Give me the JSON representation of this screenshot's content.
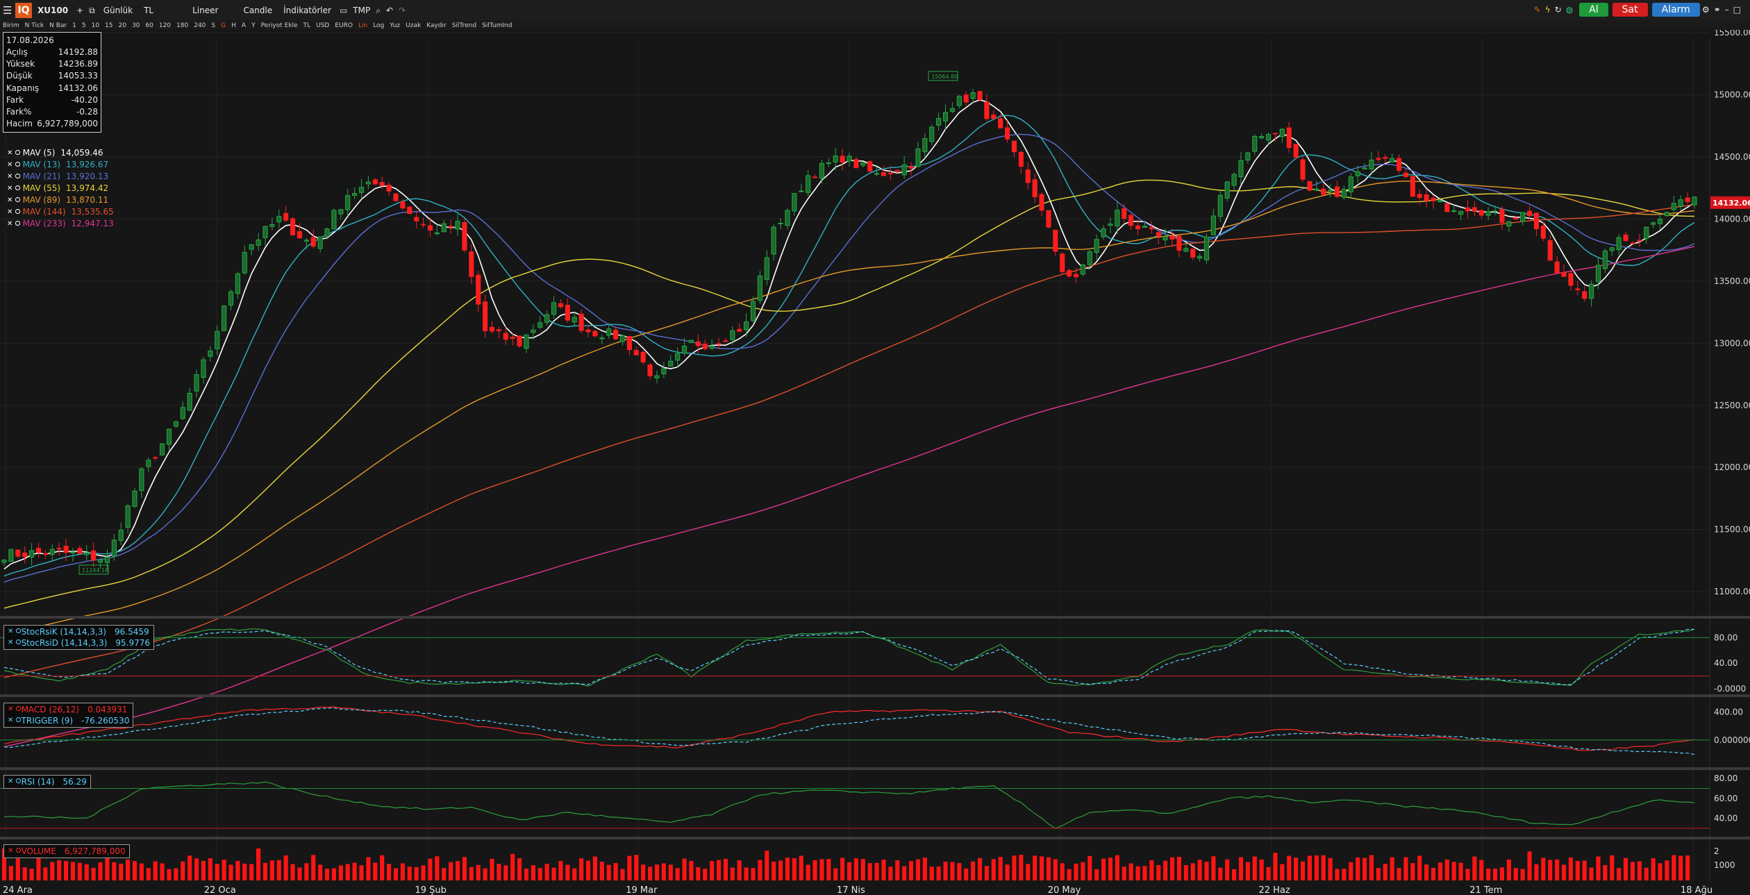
{
  "toolbar": {
    "logo": "IQ",
    "symbol": "XU100",
    "plus": "+",
    "period": "Günlük",
    "currency": "TL",
    "scale": "Lineer",
    "chart_type": "Candle",
    "indicators": "İndikatörler",
    "tmp": "TMP",
    "buy": "Al",
    "sell": "Sat",
    "alarm": "Alarm"
  },
  "subbar": [
    "Birim",
    "N Tick",
    "N Bar",
    "1",
    "5",
    "10",
    "15",
    "20",
    "30",
    "60",
    "120",
    "180",
    "240",
    "S",
    "G",
    "H",
    "A",
    "Y",
    "Periyot Ekle",
    "TL",
    "USD",
    "EURO",
    "Lin",
    "Log",
    "Yuz",
    "Uzak",
    "Kaydır",
    "SilTrend",
    "SilTumInd"
  ],
  "info": {
    "date": "17.08.2026",
    "rows": [
      {
        "label": "Açılış",
        "value": "14192.88"
      },
      {
        "label": "Yüksek",
        "value": "14236.89"
      },
      {
        "label": "Düşük",
        "value": "14053.33"
      },
      {
        "label": "Kapanış",
        "value": "14132.06"
      },
      {
        "label": "Fark",
        "value": "-40.20"
      },
      {
        "label": "Fark%",
        "value": "-0.28"
      },
      {
        "label": "Hacim",
        "value": "6,927,789,000"
      }
    ]
  },
  "mav_legend": [
    {
      "name": "MAV (5)",
      "value": "14,059.46",
      "color": "#ffffff"
    },
    {
      "name": "MAV (13)",
      "value": "13,926.67",
      "color": "#2fb3c7"
    },
    {
      "name": "MAV (21)",
      "value": "13,920.13",
      "color": "#5c6fd6"
    },
    {
      "name": "MAV (55)",
      "value": "13,974.42",
      "color": "#e8d83a"
    },
    {
      "name": "MAV (89)",
      "value": "13,870.11",
      "color": "#e69a2a"
    },
    {
      "name": "MAV (144)",
      "value": "13,535.65",
      "color": "#e0502a"
    },
    {
      "name": "MAV (233)",
      "value": "12,947.13",
      "color": "#e23590"
    }
  ],
  "stoch_legend": [
    {
      "name": "StocRsiK (14,14,3,3)",
      "value": "96.5459"
    },
    {
      "name": "StocRsiD (14,14,3,3)",
      "value": "95.9776"
    }
  ],
  "macd_legend": [
    {
      "name": "MACD (26,12)",
      "value": "0.043931"
    },
    {
      "name": "TRIGGER (9)",
      "value": "-76.260530"
    }
  ],
  "rsi_legend": [
    {
      "name": "RSI (14)",
      "value": "56.29"
    }
  ],
  "volume_legend": [
    {
      "name": "VOLUME",
      "value": "6,927,789,000"
    }
  ],
  "chart_data": {
    "type": "candlestick",
    "symbol": "XU100",
    "ylim": [
      10900,
      15450
    ],
    "y_ticks": [
      "15500.00",
      "15000.00",
      "14500.00",
      "14000.00",
      "13500.00",
      "13000.00",
      "12500.00",
      "12000.00",
      "11500.00",
      "11000.00"
    ],
    "x_ticks": [
      "24 Ara",
      "22 Oca",
      "19 Şub",
      "19 Mar",
      "17 Nis",
      "20 May",
      "22 Haz",
      "21 Tem",
      "18 Ağu"
    ],
    "last_price_label": "14132.06",
    "high_marker": "15064.80",
    "low_marker": "11244.16",
    "close_anchors": [
      [
        0,
        11300
      ],
      [
        8,
        11320
      ],
      [
        15,
        11260
      ],
      [
        20,
        11950
      ],
      [
        25,
        12350
      ],
      [
        30,
        12950
      ],
      [
        35,
        13750
      ],
      [
        40,
        14000
      ],
      [
        45,
        13780
      ],
      [
        50,
        14200
      ],
      [
        55,
        14300
      ],
      [
        58,
        14100
      ],
      [
        62,
        13900
      ],
      [
        66,
        13950
      ],
      [
        70,
        13100
      ],
      [
        75,
        13000
      ],
      [
        80,
        13300
      ],
      [
        85,
        13100
      ],
      [
        90,
        13050
      ],
      [
        95,
        12700
      ],
      [
        100,
        13000
      ],
      [
        103,
        13000
      ],
      [
        108,
        13150
      ],
      [
        112,
        13900
      ],
      [
        117,
        14350
      ],
      [
        122,
        14500
      ],
      [
        127,
        14350
      ],
      [
        132,
        14450
      ],
      [
        137,
        14900
      ],
      [
        141,
        15000
      ],
      [
        145,
        14700
      ],
      [
        150,
        14200
      ],
      [
        154,
        13600
      ],
      [
        156,
        13500
      ],
      [
        158,
        13750
      ],
      [
        162,
        14050
      ],
      [
        166,
        13900
      ],
      [
        170,
        13800
      ],
      [
        174,
        13700
      ],
      [
        178,
        14300
      ],
      [
        182,
        14650
      ],
      [
        186,
        14700
      ],
      [
        190,
        14250
      ],
      [
        194,
        14200
      ],
      [
        198,
        14450
      ],
      [
        202,
        14450
      ],
      [
        206,
        14150
      ],
      [
        210,
        14100
      ],
      [
        214,
        14100
      ],
      [
        218,
        14000
      ],
      [
        222,
        14050
      ],
      [
        226,
        13550
      ],
      [
        230,
        13400
      ],
      [
        234,
        13800
      ],
      [
        238,
        13850
      ],
      [
        240,
        14000
      ],
      [
        244,
        14150
      ],
      [
        246,
        14132
      ]
    ],
    "stoch_k": [
      [
        0,
        28
      ],
      [
        8,
        12
      ],
      [
        15,
        30
      ],
      [
        22,
        78
      ],
      [
        30,
        92
      ],
      [
        38,
        93
      ],
      [
        43,
        75
      ],
      [
        47,
        60
      ],
      [
        52,
        25
      ],
      [
        58,
        10
      ],
      [
        65,
        8
      ],
      [
        75,
        12
      ],
      [
        85,
        5
      ],
      [
        95,
        55
      ],
      [
        100,
        20
      ],
      [
        108,
        75
      ],
      [
        115,
        85
      ],
      [
        125,
        90
      ],
      [
        132,
        58
      ],
      [
        138,
        30
      ],
      [
        145,
        70
      ],
      [
        148,
        40
      ],
      [
        152,
        10
      ],
      [
        158,
        5
      ],
      [
        165,
        20
      ],
      [
        170,
        50
      ],
      [
        178,
        70
      ],
      [
        182,
        92
      ],
      [
        187,
        90
      ],
      [
        195,
        30
      ],
      [
        205,
        20
      ],
      [
        213,
        15
      ],
      [
        222,
        10
      ],
      [
        228,
        5
      ],
      [
        231,
        40
      ],
      [
        238,
        85
      ],
      [
        246,
        92
      ]
    ],
    "stoch_d": [
      [
        0,
        32
      ],
      [
        8,
        18
      ],
      [
        15,
        25
      ],
      [
        22,
        68
      ],
      [
        30,
        88
      ],
      [
        38,
        90
      ],
      [
        43,
        80
      ],
      [
        47,
        65
      ],
      [
        52,
        32
      ],
      [
        58,
        14
      ],
      [
        65,
        10
      ],
      [
        75,
        10
      ],
      [
        85,
        8
      ],
      [
        95,
        48
      ],
      [
        100,
        28
      ],
      [
        108,
        68
      ],
      [
        115,
        82
      ],
      [
        125,
        88
      ],
      [
        132,
        64
      ],
      [
        138,
        36
      ],
      [
        145,
        62
      ],
      [
        148,
        46
      ],
      [
        152,
        16
      ],
      [
        158,
        6
      ],
      [
        165,
        15
      ],
      [
        170,
        42
      ],
      [
        178,
        64
      ],
      [
        182,
        88
      ],
      [
        187,
        92
      ],
      [
        195,
        40
      ],
      [
        205,
        22
      ],
      [
        213,
        18
      ],
      [
        222,
        12
      ],
      [
        228,
        6
      ],
      [
        231,
        28
      ],
      [
        238,
        78
      ],
      [
        246,
        94
      ]
    ],
    "macd": [
      [
        0,
        -20
      ],
      [
        20,
        80
      ],
      [
        35,
        160
      ],
      [
        48,
        175
      ],
      [
        60,
        130
      ],
      [
        75,
        40
      ],
      [
        85,
        -20
      ],
      [
        98,
        -40
      ],
      [
        108,
        30
      ],
      [
        120,
        150
      ],
      [
        135,
        160
      ],
      [
        145,
        150
      ],
      [
        155,
        40
      ],
      [
        170,
        -10
      ],
      [
        178,
        20
      ],
      [
        186,
        60
      ],
      [
        195,
        30
      ],
      [
        210,
        10
      ],
      [
        222,
        -20
      ],
      [
        230,
        -60
      ],
      [
        240,
        -30
      ],
      [
        246,
        0
      ]
    ],
    "macd_trigger": [
      [
        0,
        -40
      ],
      [
        20,
        50
      ],
      [
        35,
        135
      ],
      [
        48,
        170
      ],
      [
        60,
        150
      ],
      [
        75,
        80
      ],
      [
        85,
        20
      ],
      [
        98,
        -30
      ],
      [
        108,
        -10
      ],
      [
        120,
        80
      ],
      [
        135,
        135
      ],
      [
        145,
        150
      ],
      [
        155,
        90
      ],
      [
        170,
        10
      ],
      [
        178,
        0
      ],
      [
        186,
        30
      ],
      [
        195,
        40
      ],
      [
        210,
        20
      ],
      [
        222,
        -10
      ],
      [
        230,
        -50
      ],
      [
        240,
        -60
      ],
      [
        246,
        -76
      ]
    ],
    "rsi": [
      [
        0,
        42
      ],
      [
        12,
        40
      ],
      [
        20,
        70
      ],
      [
        30,
        74
      ],
      [
        38,
        76
      ],
      [
        45,
        64
      ],
      [
        55,
        52
      ],
      [
        62,
        49
      ],
      [
        68,
        51
      ],
      [
        75,
        38
      ],
      [
        82,
        46
      ],
      [
        90,
        40
      ],
      [
        97,
        36
      ],
      [
        103,
        44
      ],
      [
        110,
        64
      ],
      [
        118,
        68
      ],
      [
        126,
        66
      ],
      [
        132,
        65
      ],
      [
        138,
        70
      ],
      [
        144,
        72
      ],
      [
        148,
        55
      ],
      [
        153,
        30
      ],
      [
        158,
        46
      ],
      [
        164,
        48
      ],
      [
        170,
        45
      ],
      [
        174,
        52
      ],
      [
        178,
        60
      ],
      [
        184,
        62
      ],
      [
        190,
        56
      ],
      [
        196,
        58
      ],
      [
        204,
        52
      ],
      [
        212,
        48
      ],
      [
        222,
        36
      ],
      [
        228,
        33
      ],
      [
        234,
        46
      ],
      [
        240,
        58
      ],
      [
        246,
        56
      ]
    ],
    "volume_bars": 246
  }
}
